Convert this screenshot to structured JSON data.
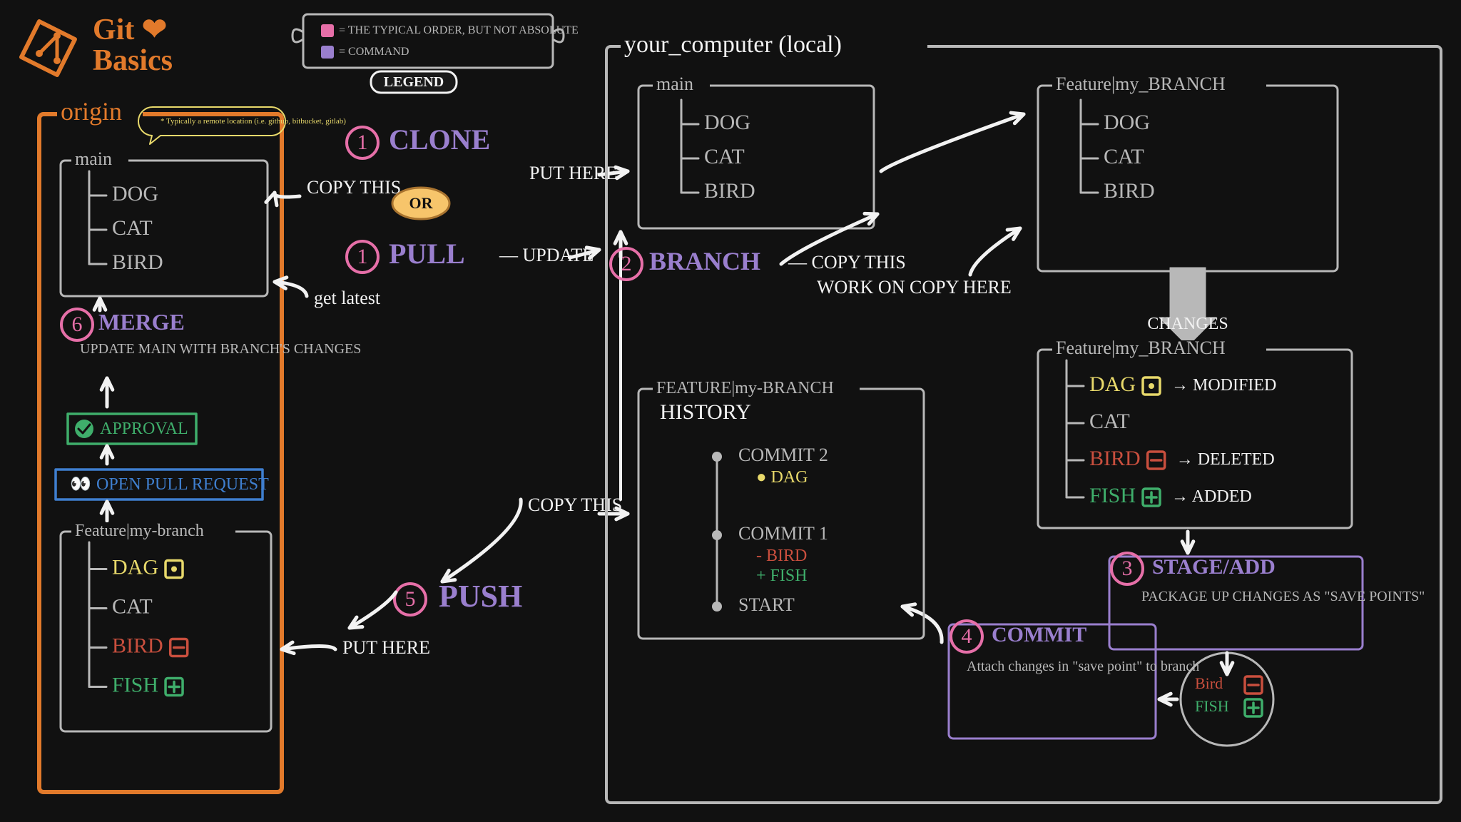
{
  "title_line1": "Git ❤",
  "title_line2": "Basics",
  "legend": {
    "title": "LEGEND",
    "items": [
      {
        "swatch": "pink",
        "text": "= THE TYPICAL ORDER, BUT NOT ABSOLUTE"
      },
      {
        "swatch": "purple",
        "text": "= COMMAND"
      }
    ]
  },
  "origin": {
    "title": "origin",
    "note": "* Typically a remote location (i.e. github, bitbucket, gitlab)",
    "main": {
      "label": "main",
      "files": [
        "DOG",
        "CAT",
        "BIRD"
      ]
    },
    "merge": {
      "num": "6",
      "label": "MERGE",
      "desc": "UPDATE MAIN WITH BRANCH'S CHANGES"
    },
    "approval": "APPROVAL",
    "pr": "OPEN PULL REQUEST",
    "feature": {
      "label": "Feature|my-branch",
      "files": [
        {
          "name": "DAG",
          "state": "modified"
        },
        {
          "name": "CAT",
          "state": "none"
        },
        {
          "name": "BIRD",
          "state": "deleted"
        },
        {
          "name": "FISH",
          "state": "added"
        }
      ]
    }
  },
  "between": {
    "clone": {
      "num": "1",
      "label": "CLONE",
      "left": "COPY THIS",
      "right": "PUT HERE"
    },
    "or": "OR",
    "pull": {
      "num": "1",
      "label": "PULL",
      "right": "UPDATE",
      "below": "get latest"
    },
    "push": {
      "num": "5",
      "label": "PUSH",
      "left": "COPY THIS",
      "below": "PUT HERE"
    }
  },
  "local": {
    "title": "your_computer (local)",
    "main": {
      "label": "main",
      "files": [
        "DOG",
        "CAT",
        "BIRD"
      ]
    },
    "branch": {
      "num": "2",
      "label": "BRANCH",
      "desc1": "COPY THIS",
      "desc2": "WORK ON COPY HERE"
    },
    "feature_clean": {
      "label": "Feature|my_BRANCH",
      "files": [
        "DOG",
        "CAT",
        "BIRD"
      ]
    },
    "changes_label": "CHANGES",
    "feature_dirty": {
      "label": "Feature|my_BRANCH",
      "files": [
        {
          "name": "DAG",
          "state": "modified",
          "tag": "→ MODIFIED"
        },
        {
          "name": "CAT",
          "state": "none",
          "tag": ""
        },
        {
          "name": "BIRD",
          "state": "deleted",
          "tag": "→ DELETED"
        },
        {
          "name": "FISH",
          "state": "added",
          "tag": "→ ADDED"
        }
      ]
    },
    "stage": {
      "num": "3",
      "label": "STAGE/ADD",
      "desc": "PACKAGE UP CHANGES AS \"SAVE POINTS\""
    },
    "savepoint": [
      {
        "name": "Bird",
        "state": "deleted"
      },
      {
        "name": "FISH",
        "state": "added"
      }
    ],
    "commit": {
      "num": "4",
      "label": "COMMIT",
      "desc": "Attach changes in \"save point\" to branch"
    },
    "history": {
      "label": "FEATURE|my-BRANCH",
      "subtitle": "HISTORY",
      "commits": [
        {
          "name": "COMMIT 2",
          "changes": [
            {
              "sym": "●",
              "color": "#e8d96b",
              "text": "DAG"
            }
          ]
        },
        {
          "name": "COMMIT 1",
          "changes": [
            {
              "sym": "-",
              "color": "#c94f3e",
              "text": "BIRD"
            },
            {
              "sym": "+",
              "color": "#3fae6b",
              "text": "FISH"
            }
          ]
        },
        {
          "name": "START",
          "changes": []
        }
      ]
    }
  },
  "colors": {
    "orange": "#e27a2b",
    "pink": "#e66fa8",
    "purple": "#9a7fce",
    "yellow": "#e8d96b",
    "green": "#3fae6b",
    "red": "#c94f3e",
    "blue": "#3f7fcf",
    "grey": "#b8b8b8",
    "white": "#f2f2f2"
  }
}
